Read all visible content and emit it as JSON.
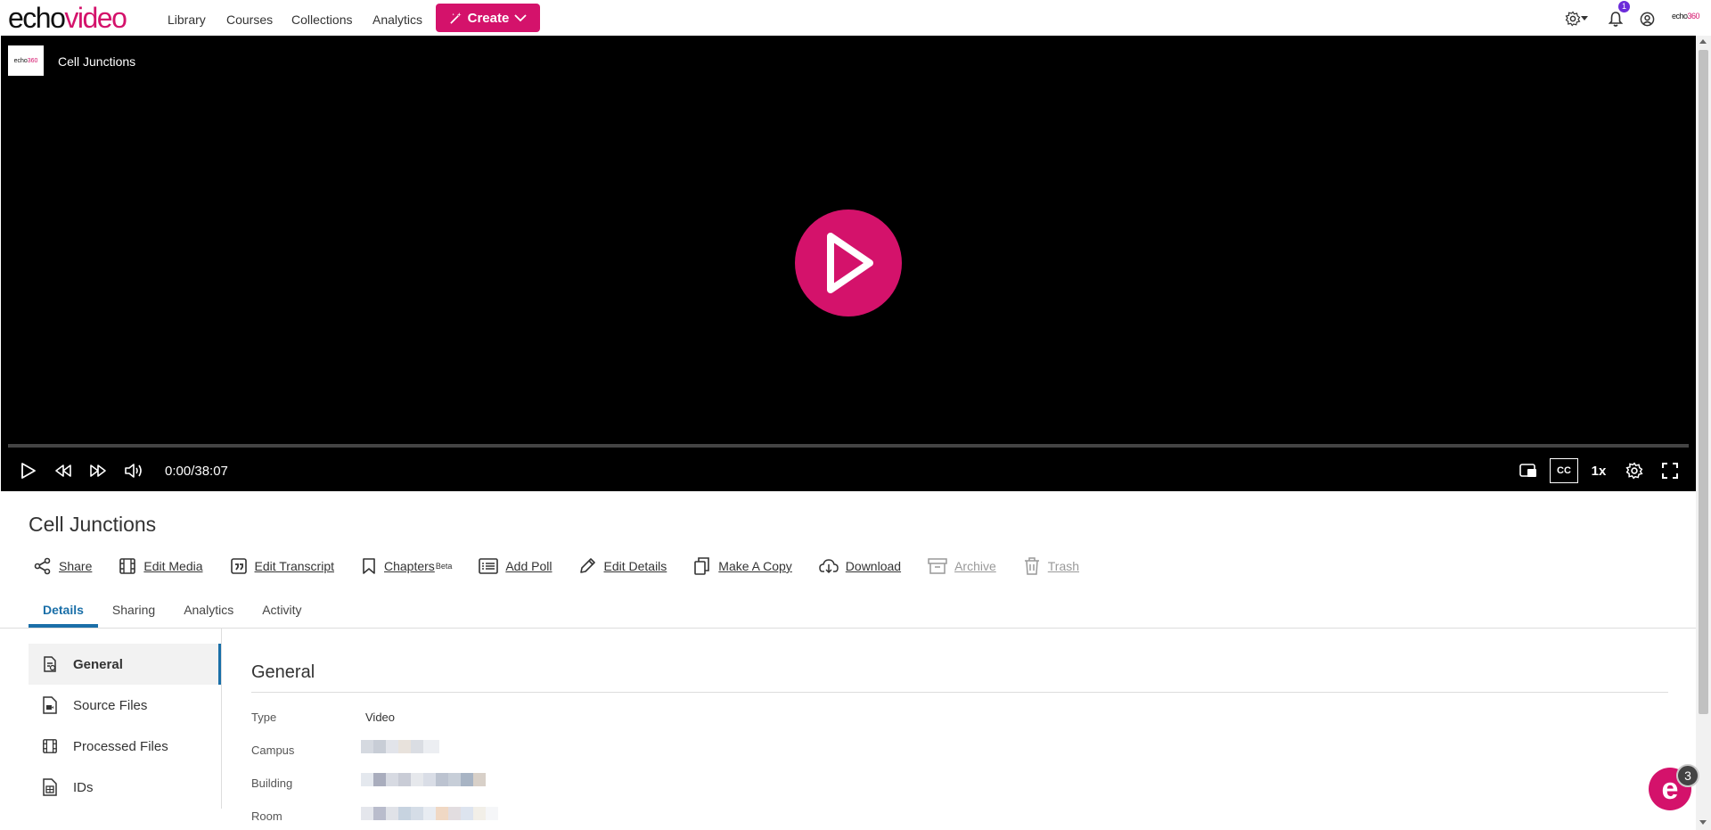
{
  "brand": {
    "logo_part1": "echo",
    "logo_part2": "video",
    "accent": "#d4126b",
    "tab_accent": "#1a6fa8"
  },
  "nav": {
    "links": [
      "Library",
      "Courses",
      "Collections",
      "Analytics"
    ],
    "create_label": "Create",
    "notification_count": "1",
    "corner_logo_a": "echo",
    "corner_logo_b": "360"
  },
  "player": {
    "title": "Cell Junctions",
    "thumb_a": "echo",
    "thumb_b": "360",
    "time": "0:00/38:07",
    "progress": 0.0,
    "cc_label": "CC",
    "speed": "1x"
  },
  "media": {
    "title": "Cell Junctions",
    "actions": [
      {
        "label": "Share",
        "icon": "share-icon",
        "disabled": false
      },
      {
        "label": "Edit Media",
        "icon": "film-icon",
        "disabled": false
      },
      {
        "label": "Edit Transcript",
        "icon": "quote-icon",
        "disabled": false
      },
      {
        "label": "Chapters",
        "sup": "Beta",
        "icon": "bookmark-icon",
        "disabled": false
      },
      {
        "label": "Add Poll",
        "icon": "list-icon",
        "disabled": false
      },
      {
        "label": "Edit Details",
        "icon": "pencil-icon",
        "disabled": false
      },
      {
        "label": "Make A Copy",
        "icon": "copy-icon",
        "disabled": false
      },
      {
        "label": "Download",
        "icon": "download-icon",
        "disabled": false
      },
      {
        "label": "Archive",
        "icon": "archive-icon",
        "disabled": true
      },
      {
        "label": "Trash",
        "icon": "trash-icon",
        "disabled": true
      }
    ]
  },
  "tabs": [
    "Details",
    "Sharing",
    "Analytics",
    "Activity"
  ],
  "active_tab": "Details",
  "sidenav": [
    {
      "label": "General",
      "icon": "document-icon",
      "active": true
    },
    {
      "label": "Source Files",
      "icon": "file-video-icon",
      "active": false
    },
    {
      "label": "Processed Files",
      "icon": "film-icon",
      "active": false
    },
    {
      "label": "IDs",
      "icon": "id-icon",
      "active": false
    }
  ],
  "general": {
    "title": "General",
    "fields": [
      {
        "label": "Type",
        "value": "Video"
      },
      {
        "label": "Campus",
        "value": ""
      },
      {
        "label": "Building",
        "value": ""
      },
      {
        "label": "Room",
        "value": ""
      }
    ]
  },
  "chat": {
    "badge": "3",
    "glyph": "e"
  }
}
